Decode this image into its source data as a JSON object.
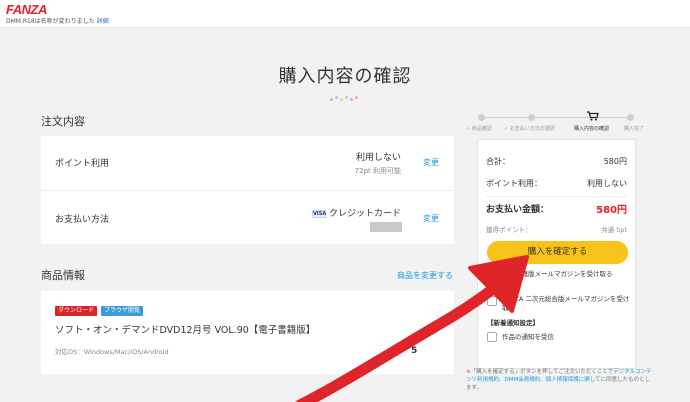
{
  "header": {
    "logo": "FANZA",
    "rename_notice": "DMM.R18は名称が変わりました",
    "rename_link": "詳細"
  },
  "page_title": "購入内容の確認",
  "order": {
    "section_title": "注文内容",
    "points": {
      "label": "ポイント利用",
      "value": "利用しない",
      "sub": "72pt 利用可能",
      "change": "変更"
    },
    "payment": {
      "label": "お支払い方法",
      "card_brand": "VISA",
      "value": "クレジットカード",
      "change": "変更"
    }
  },
  "product": {
    "section_title": "商品情報",
    "change_link": "商品を変更する",
    "badges": [
      "ダウンロード",
      "ブラウザ閲覧"
    ],
    "title": "ソフト・オン・デマンドDVD12月号 VOL.90【電子書籍版】",
    "os": "対応OS：Windows/Mac/iOS/Android",
    "price_partial": "5"
  },
  "steps": [
    "商品確認",
    "お支払い方法の選択",
    "購入内容の確認",
    "購入完了"
  ],
  "summary": {
    "total_label": "合計：",
    "total_value": "580円",
    "points_label": "ポイント利用：",
    "points_value": "利用しない",
    "pay_label": "お支払い金額：",
    "pay_value": "580円",
    "earn_label": "獲得ポイント：",
    "earn_value": "共通  5pt",
    "confirm_button": "購入を確定する",
    "options": [
      "電子書籍版メールマガジンを受け取る",
      "FANZA 二次元総合版メールマガジンを受け取る"
    ],
    "notify_title": "【新着通知設定】",
    "notify_option": "作品の通知を受信"
  },
  "terms": {
    "prefix": "※「購入を確定する」ボタンを押してご注文いただくことで",
    "links": "デジタルコンテンツ利用規約、DMM会員規約、個人情報保護に関して",
    "suffix": "に同意したものとします。"
  },
  "colors": {
    "brand": "#e51f2b",
    "link": "#1f9ad6",
    "confirm": "#f7c21a",
    "price": "#e51f2b",
    "badge_download": "#d9262a",
    "badge_browser": "#3b9bd6",
    "annotation_arrow": "#e0252a"
  }
}
